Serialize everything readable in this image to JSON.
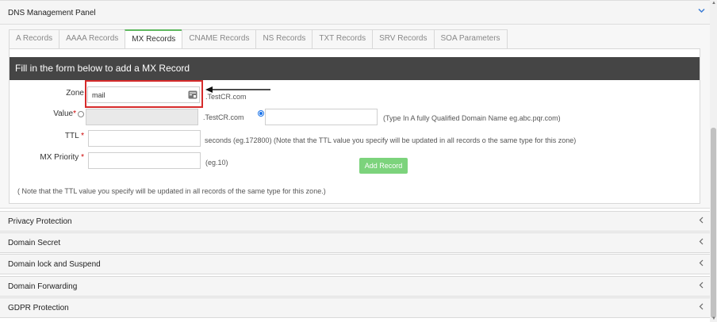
{
  "dns_panel": {
    "title": "DNS Management Panel",
    "tabs": [
      {
        "label": "A Records",
        "active": false
      },
      {
        "label": "AAAA Records",
        "active": false
      },
      {
        "label": "MX Records",
        "active": true
      },
      {
        "label": "CNAME Records",
        "active": false
      },
      {
        "label": "NS Records",
        "active": false
      },
      {
        "label": "TXT Records",
        "active": false
      },
      {
        "label": "SRV Records",
        "active": false
      },
      {
        "label": "SOA Parameters",
        "active": false
      }
    ],
    "form": {
      "header": "Fill in the form below to add a MX Record",
      "zone_label": "Zone",
      "zone_value": "mail",
      "zone_suffix": ".TestCR.com",
      "value_label": "Value",
      "value_required": "*",
      "value_suffix": ".TestCR.com",
      "value_hint": "(Type In A fully Qualified Domain Name eg.abc.pqr.com)",
      "ttl_label": "TTL",
      "ttl_required": "*",
      "ttl_hint": "seconds (eg.172800) (Note that the TTL value you specify will be updated in all records o the same type for this zone)",
      "priority_label": "MX Priority",
      "priority_required": "*",
      "priority_hint": "(eg.10)",
      "add_button": "Add Record",
      "footer_note": "( Note that the TTL value you specify will be updated in all records of the same type for this zone.)"
    }
  },
  "panels": [
    {
      "label": "Privacy Protection"
    },
    {
      "label": "Domain Secret"
    },
    {
      "label": "Domain lock and Suspend"
    },
    {
      "label": "Domain Forwarding"
    },
    {
      "label": "GDPR Protection"
    }
  ],
  "icons": {
    "collapse": "chevron-down-icon",
    "expand": "chevron-left-icon"
  },
  "colors": {
    "active_tab_accent": "#5fb85f",
    "form_header_bg": "#454545",
    "highlight": "#d62b2b",
    "button": "#7cd37c"
  }
}
